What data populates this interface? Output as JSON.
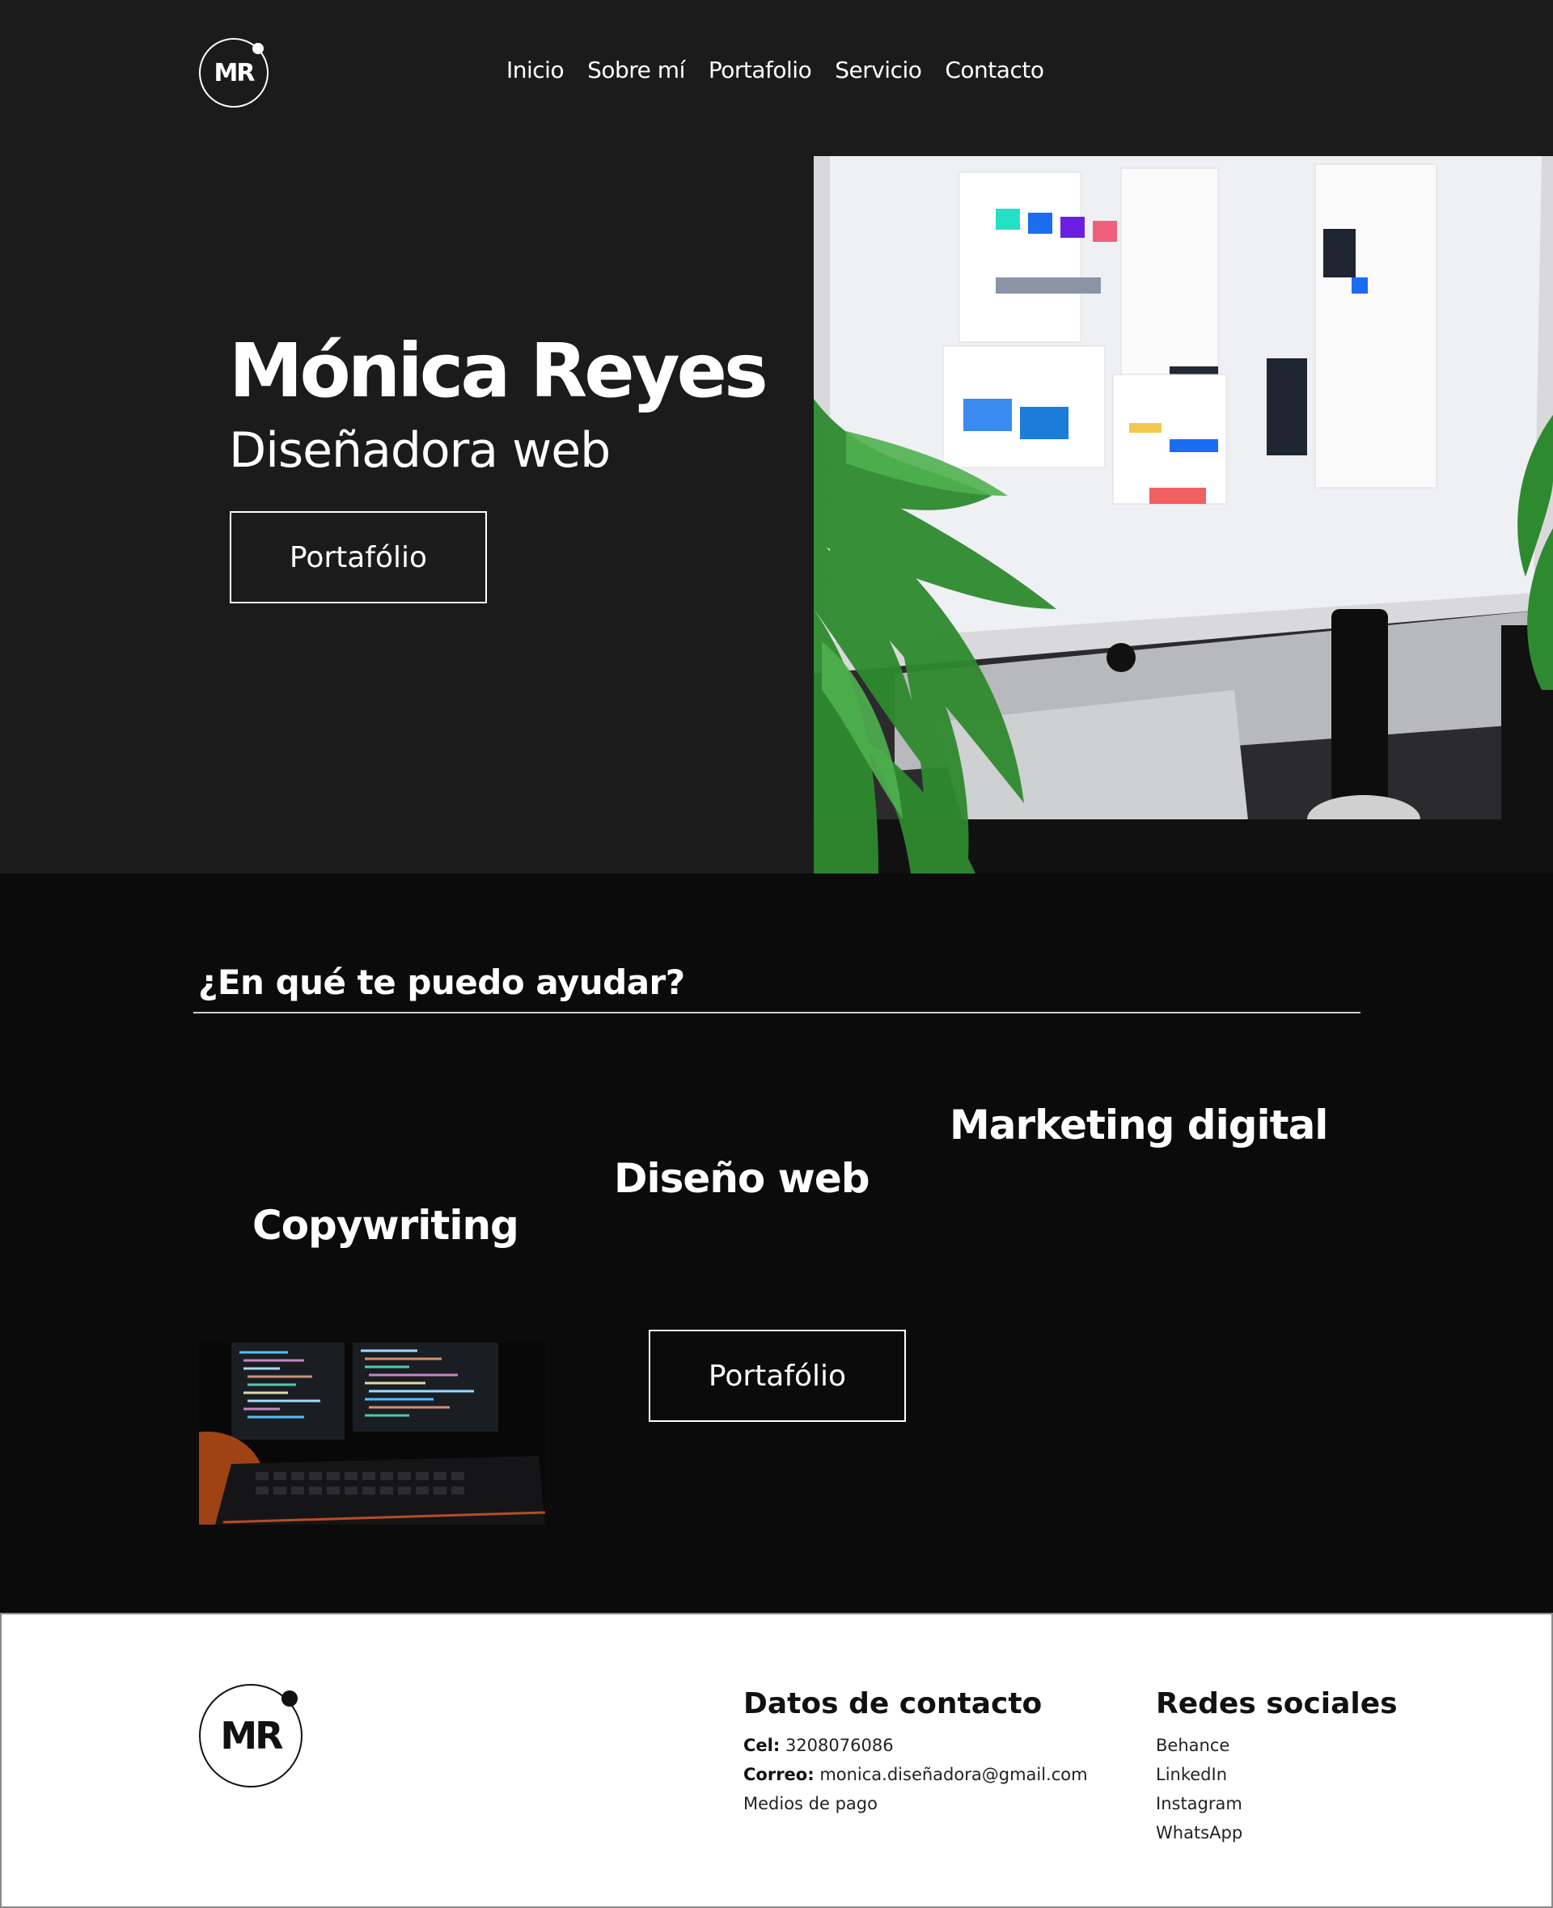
{
  "brand": {
    "logo_text": "MR"
  },
  "nav": {
    "items": [
      "Inicio",
      "Sobre mí",
      "Portafolio",
      "Servicio",
      "Contacto"
    ]
  },
  "hero": {
    "name": "Mónica Reyes",
    "role": "Diseñadora web",
    "button_label": "Portafólio",
    "image_alt": "monitor-with-ui-design-and-plants"
  },
  "services": {
    "heading": "¿En qué te puedo ayudar?",
    "items": {
      "marketing": "Marketing digital",
      "diseno": "Diseño web",
      "copywriting": "Copywriting"
    },
    "button_label": "Portafólio",
    "image_alt": "code-on-monitors-and-keyboard"
  },
  "footer": {
    "logo_text": "MR",
    "contact": {
      "title": "Datos de contacto",
      "cel_label": "Cel:",
      "cel_value": "3208076086",
      "email_label": "Correo:",
      "email_value": "monica.diseñadora@gmail.com",
      "payment": "Medios de pago"
    },
    "social": {
      "title": "Redes sociales",
      "links": [
        "Behance",
        "LinkedIn",
        "Instagram",
        "WhatsApp"
      ]
    }
  },
  "colors": {
    "hero_bg": "#1b1b1c",
    "services_bg": "#0b0b0c",
    "footer_bg": "#ffffff",
    "text_light": "#ffffff",
    "text_dark": "#111111"
  }
}
